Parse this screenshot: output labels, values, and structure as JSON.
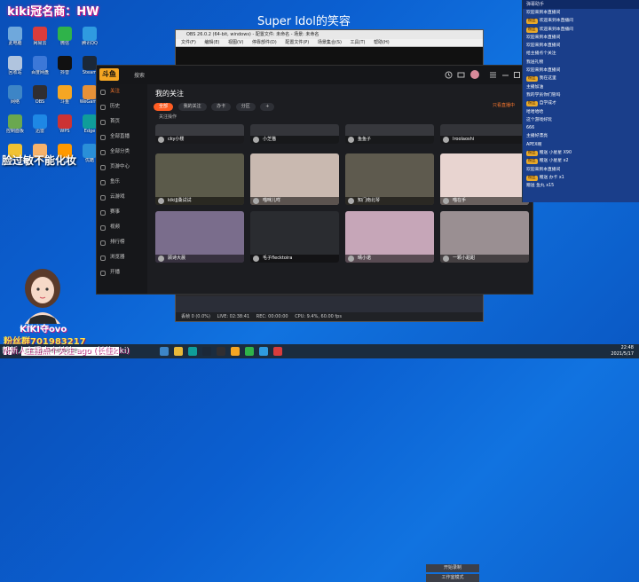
{
  "overlay": {
    "stream_title": "kiki冠名商：HW",
    "song_title": "Super Idol的笑容",
    "side_tagline": "脸过敏不能化妆",
    "streamer_id": "KIKI夺ovo",
    "fans_group": "粉丝群701983217",
    "ticker": "帮新人主播点个关注 ago (长佳kiki)",
    "socials": "♪ tiktok ◎"
  },
  "desktop_icons": [
    {
      "label": "此电脑",
      "color": "#6fa8dc"
    },
    {
      "label": "网易云",
      "color": "#d93c3c"
    },
    {
      "label": "微信",
      "color": "#2fb34a"
    },
    {
      "label": "腾讯QQ",
      "color": "#2f9be0"
    },
    {
      "label": "回收站",
      "color": "#b0c4de"
    },
    {
      "label": "百度网盘",
      "color": "#3c78d8"
    },
    {
      "label": "抖音",
      "color": "#111111"
    },
    {
      "label": "Steam",
      "color": "#1b2838"
    },
    {
      "label": "网络",
      "color": "#3d85c6"
    },
    {
      "label": "OBS",
      "color": "#302e31"
    },
    {
      "label": "斗鱼",
      "color": "#f5a623"
    },
    {
      "label": "WeGame",
      "color": "#e69138"
    },
    {
      "label": "控制面板",
      "color": "#6aa84f"
    },
    {
      "label": "迅雷",
      "color": "#1e88e5"
    },
    {
      "label": "WPS",
      "color": "#cc3333"
    },
    {
      "label": "Edge",
      "color": "#0f9d9a"
    },
    {
      "label": "Chrome",
      "color": "#f1c232"
    },
    {
      "label": "YY",
      "color": "#f6b26b"
    },
    {
      "label": "虎牙",
      "color": "#ff9900"
    },
    {
      "label": "优酷",
      "color": "#2a8fd8"
    }
  ],
  "obs": {
    "title": "OBS 26.0.2 (64-bit, windows) - 配置文件: 未命名 - 场景: 未命名",
    "menu": [
      "文件(F)",
      "编辑(E)",
      "视图(V)",
      "停靠部件(D)",
      "配置文件(P)",
      "场景集合(S)",
      "工具(T)",
      "帮助(H)"
    ],
    "status": [
      "丢帧 0 (0.0%)",
      "LIVE: 02:38:41",
      "REC: 00:00:00",
      "CPU: 9.4%, 60.00 fps"
    ],
    "controls": [
      "开始录制",
      "工作室模式",
      "设置",
      "退出"
    ]
  },
  "app": {
    "logo": "斗鱼",
    "search_placeholder": "搜索",
    "page_title": "我的关注",
    "filters": [
      "全部",
      "我的关注",
      "办卡",
      "分区",
      "+"
    ],
    "manage_label": "关注操作",
    "live_only": "只看直播中",
    "sidebar": [
      {
        "label": "关注",
        "active": true
      },
      {
        "label": "历史",
        "active": false
      },
      {
        "label": "首页",
        "active": false
      },
      {
        "label": "全部直播",
        "active": false
      },
      {
        "label": "全部分类",
        "active": false
      },
      {
        "label": "页游中心",
        "active": false
      },
      {
        "label": "鱼乐",
        "active": false
      },
      {
        "label": "云游戏",
        "active": false
      },
      {
        "label": "赛事",
        "active": false
      },
      {
        "label": "视频",
        "active": false
      },
      {
        "label": "排行榜",
        "active": false
      },
      {
        "label": "浏览器",
        "active": false
      },
      {
        "label": "开播",
        "active": false
      }
    ],
    "cards": [
      {
        "name": "cky小楼",
        "color": "#3a3b40"
      },
      {
        "name": "小芝猫",
        "color": "#34353a"
      },
      {
        "name": "鱼鱼子",
        "color": "#37383d"
      },
      {
        "name": "Iroolaoshi",
        "color": "#333439"
      },
      {
        "name": "kikiJJ桑试试",
        "color": "#5b5a4a"
      },
      {
        "name": "喵咪儿咩",
        "color": "#c9b9b0"
      },
      {
        "name": "知门南北琴",
        "color": "#5e5a4e"
      },
      {
        "name": "喵在手",
        "color": "#e8d4d0"
      },
      {
        "name": "顾诗大晨",
        "color": "#7a6d8c"
      },
      {
        "name": "毛子flecktoira",
        "color": "#2a2c30"
      },
      {
        "name": "晴小诺",
        "color": "#c6a6b8"
      },
      {
        "name": "一颗小甜甜",
        "color": "#9a8f92"
      }
    ]
  },
  "chat": {
    "header": "弹幕助手",
    "messages": [
      {
        "badge": "",
        "text": "欢迎来到本直播间"
      },
      {
        "badge": "粉丝",
        "text": "欢迎来到本直播间"
      },
      {
        "badge": "粉丝",
        "text": "欢迎来到本直播间"
      },
      {
        "badge": "",
        "text": "欢迎来到本直播间"
      },
      {
        "badge": "",
        "text": "欢迎来到本直播间"
      },
      {
        "badge": "",
        "text": "给主播点个关注"
      },
      {
        "badge": "",
        "text": "我送礼物"
      },
      {
        "badge": "",
        "text": "欢迎来到本直播间"
      },
      {
        "badge": "粉丝",
        "text": "我在这里"
      },
      {
        "badge": "",
        "text": "主播加油"
      },
      {
        "badge": "",
        "text": "我的学员你们管吗"
      },
      {
        "badge": "粉丝",
        "text": "自学成才"
      },
      {
        "badge": "",
        "text": "哈哈哈哈"
      },
      {
        "badge": "",
        "text": "这个游戏好玩"
      },
      {
        "badge": "",
        "text": "666"
      },
      {
        "badge": "",
        "text": "主播好漂亮"
      },
      {
        "badge": "",
        "text": "APEX啊"
      },
      {
        "badge": "粉丝",
        "text": "赠送 小星星 X90"
      },
      {
        "badge": "粉丝",
        "text": "赠送 小星星 x2"
      },
      {
        "badge": "",
        "text": "欢迎来到本直播间"
      },
      {
        "badge": "粉丝",
        "text": "赠送 办卡 x1"
      },
      {
        "badge": "",
        "text": "赠送 鱼丸 x15"
      }
    ]
  },
  "taskbar": {
    "search_placeholder": "在这里输入你要搜索的内容",
    "time": "22:48",
    "date": "2021/5/17"
  }
}
